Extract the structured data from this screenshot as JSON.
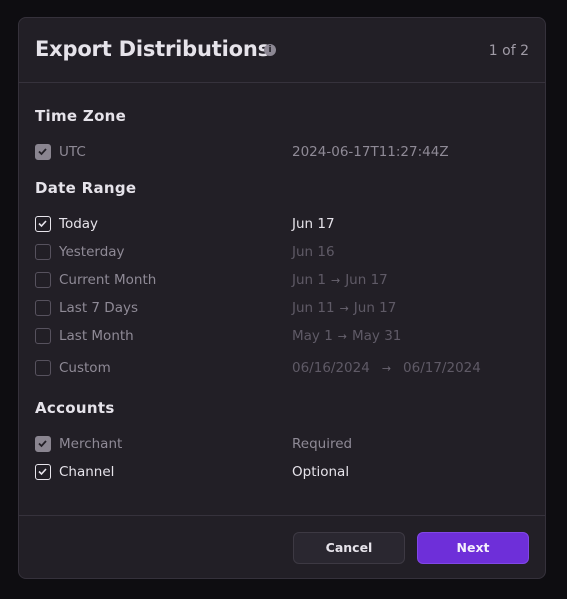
{
  "modal": {
    "title": "Export Distributions",
    "step": "1 of 2",
    "info_icon": "info-icon"
  },
  "time_zone": {
    "heading": "Time Zone",
    "option": {
      "label": "UTC",
      "value": "2024-06-17T11:27:44Z",
      "checked": true,
      "disabled": true
    }
  },
  "date_range": {
    "heading": "Date Range",
    "options": [
      {
        "label": "Today",
        "from": "Jun 17",
        "to": "",
        "checked": true
      },
      {
        "label": "Yesterday",
        "from": "Jun 16",
        "to": "",
        "checked": false
      },
      {
        "label": "Current Month",
        "from": "Jun 1",
        "to": "Jun 17",
        "checked": false
      },
      {
        "label": "Last 7 Days",
        "from": "Jun 11",
        "to": "Jun 17",
        "checked": false
      },
      {
        "label": "Last Month",
        "from": "May 1",
        "to": "May 31",
        "checked": false
      },
      {
        "label": "Custom",
        "from": "06/16/2024",
        "to": "06/17/2024",
        "checked": false
      }
    ]
  },
  "accounts": {
    "heading": "Accounts",
    "options": [
      {
        "label": "Merchant",
        "value": "Required",
        "checked": true,
        "disabled": true
      },
      {
        "label": "Channel",
        "value": "Optional",
        "checked": true,
        "disabled": false
      }
    ]
  },
  "footer": {
    "cancel_label": "Cancel",
    "next_label": "Next"
  },
  "colors": {
    "accent": "#6e2fd9",
    "surface": "#221f26"
  }
}
